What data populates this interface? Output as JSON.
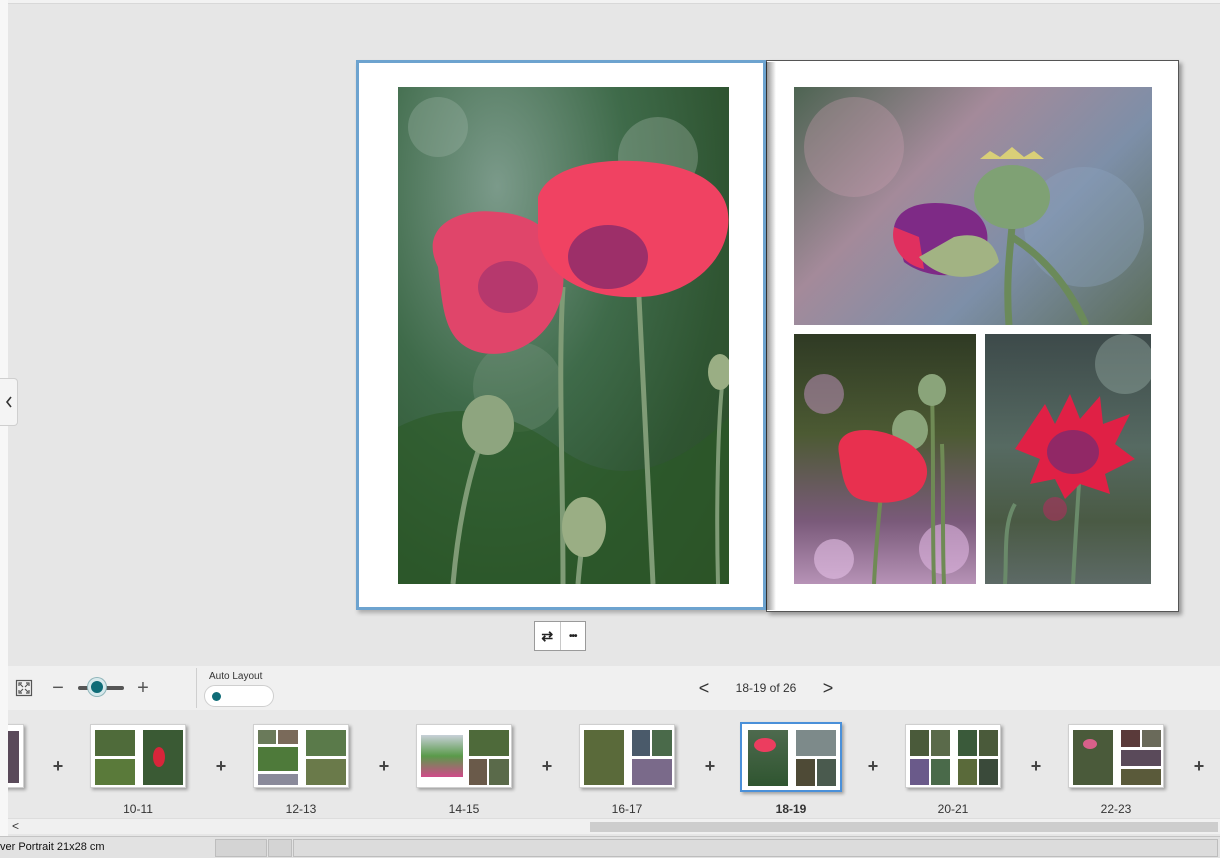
{
  "editor": {
    "page_tools": [
      {
        "name": "swap-pages-icon",
        "glyph": "⇄"
      },
      {
        "name": "more-options-icon",
        "glyph": "•••"
      }
    ]
  },
  "toolbar": {
    "zoom_minus": "−",
    "zoom_plus": "+",
    "zoom_level": 0.4,
    "auto_layout_label": "Auto Layout",
    "auto_layout_on": false,
    "prev_glyph": "<",
    "next_glyph": ">",
    "page_indicator": "18-19 of 26"
  },
  "thumbnails": [
    {
      "label": "",
      "active": false
    },
    {
      "label": "10-11",
      "active": false
    },
    {
      "label": "12-13",
      "active": false
    },
    {
      "label": "14-15",
      "active": false
    },
    {
      "label": "16-17",
      "active": false
    },
    {
      "label": "18-19",
      "active": true
    },
    {
      "label": "20-21",
      "active": false
    },
    {
      "label": "22-23",
      "active": false
    }
  ],
  "plus_glyph": "+",
  "scrollbar": {
    "left_arrow": "<"
  },
  "status": {
    "text": "ver Portrait 21x28 cm"
  },
  "colors": {
    "accent": "#0f6c77",
    "selection": "#4a90d9"
  }
}
